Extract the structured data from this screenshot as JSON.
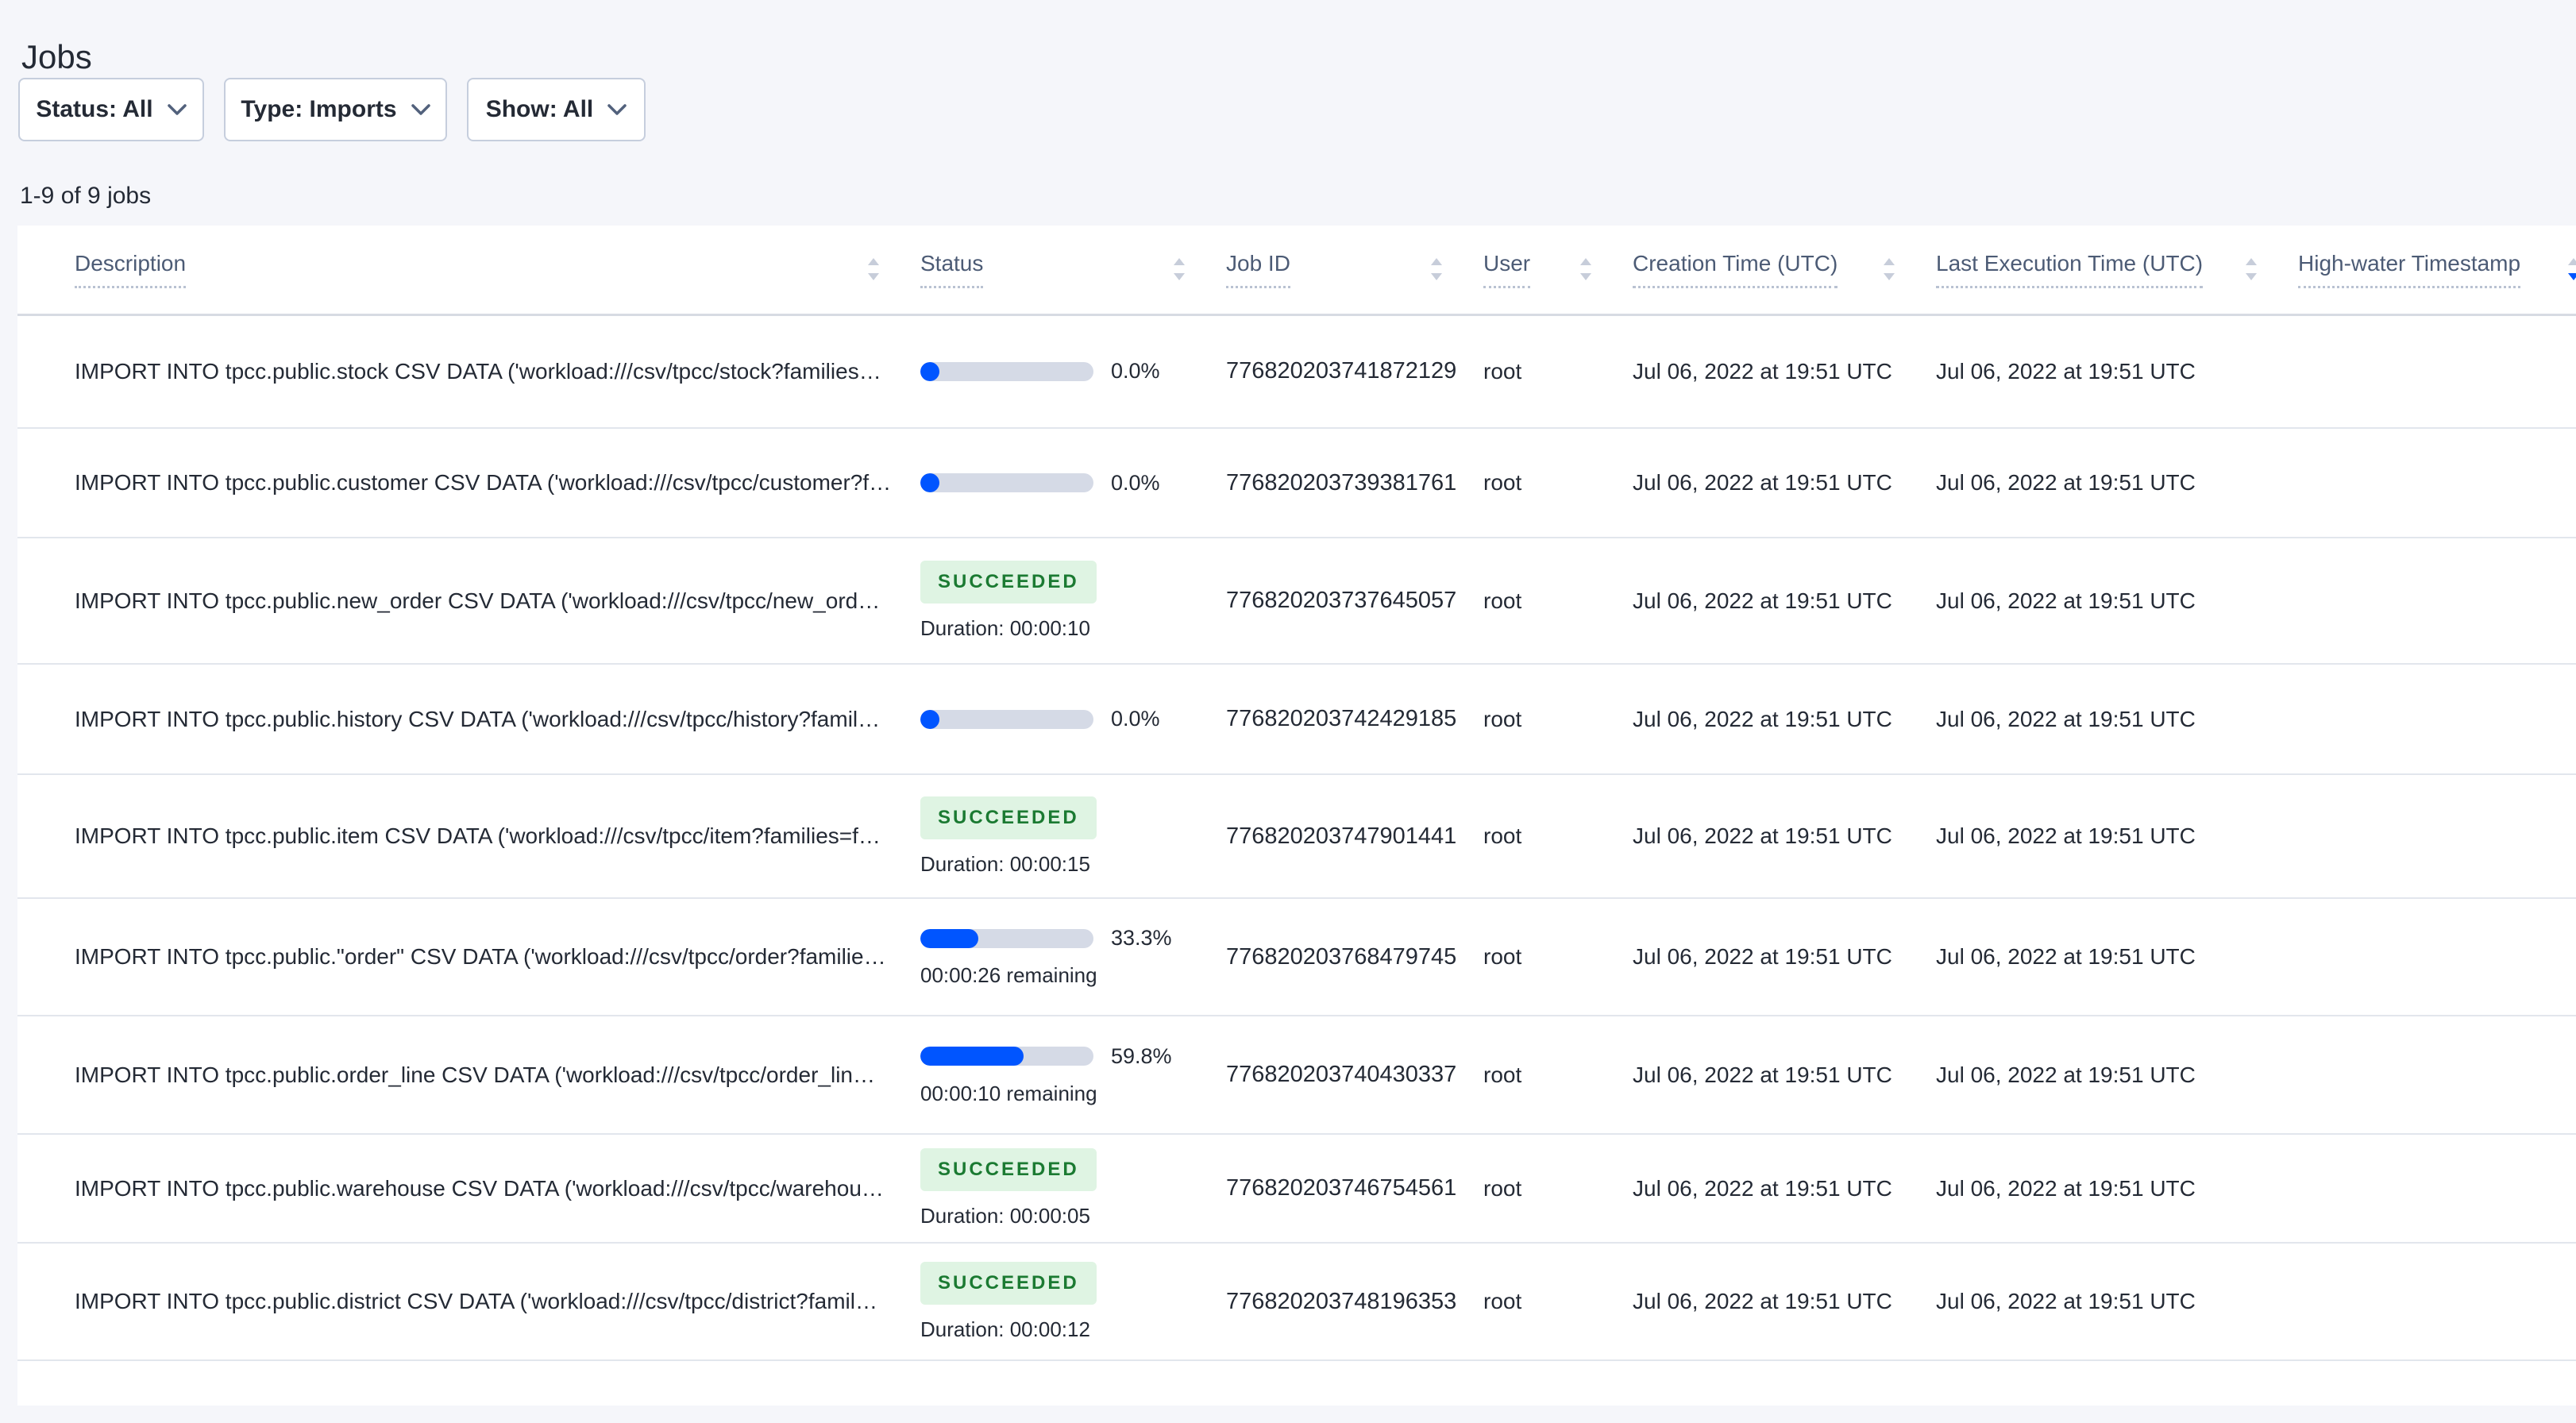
{
  "page": {
    "title": "Jobs",
    "summary": "1-9 of 9 jobs"
  },
  "filters": {
    "status_label": "Status: All",
    "type_label": "Type: Imports",
    "show_label": "Show: All"
  },
  "table": {
    "columns": [
      "Description",
      "Status",
      "Job ID",
      "User",
      "Creation Time (UTC)",
      "Last Execution Time (UTC)",
      "High-water Timestamp"
    ],
    "sort": {
      "column": "High-water Timestamp",
      "direction": "desc"
    },
    "succeeded_label": "SUCCEEDED",
    "rows": [
      {
        "description": "IMPORT INTO tpcc.public.stock CSV DATA ('workload:///csv/tpcc/stock?families…",
        "status": {
          "state": "running",
          "percent": "0.0%",
          "fraction": 0.0,
          "remaining": null
        },
        "job_id": "776820203741872129",
        "user": "root",
        "creation_time": "Jul 06, 2022 at 19:51 UTC",
        "last_execution_time": "Jul 06, 2022 at 19:51 UTC",
        "high_water": ""
      },
      {
        "description": "IMPORT INTO tpcc.public.customer CSV DATA ('workload:///csv/tpcc/customer?f…",
        "status": {
          "state": "running",
          "percent": "0.0%",
          "fraction": 0.0,
          "remaining": null
        },
        "job_id": "776820203739381761",
        "user": "root",
        "creation_time": "Jul 06, 2022 at 19:51 UTC",
        "last_execution_time": "Jul 06, 2022 at 19:51 UTC",
        "high_water": ""
      },
      {
        "description": "IMPORT INTO tpcc.public.new_order CSV DATA ('workload:///csv/tpcc/new_ord…",
        "status": {
          "state": "succeeded",
          "duration": "Duration: 00:00:10"
        },
        "job_id": "776820203737645057",
        "user": "root",
        "creation_time": "Jul 06, 2022 at 19:51 UTC",
        "last_execution_time": "Jul 06, 2022 at 19:51 UTC",
        "high_water": ""
      },
      {
        "description": "IMPORT INTO tpcc.public.history CSV DATA ('workload:///csv/tpcc/history?famil…",
        "status": {
          "state": "running",
          "percent": "0.0%",
          "fraction": 0.0,
          "remaining": null
        },
        "job_id": "776820203742429185",
        "user": "root",
        "creation_time": "Jul 06, 2022 at 19:51 UTC",
        "last_execution_time": "Jul 06, 2022 at 19:51 UTC",
        "high_water": ""
      },
      {
        "description": "IMPORT INTO tpcc.public.item CSV DATA ('workload:///csv/tpcc/item?families=f…",
        "status": {
          "state": "succeeded",
          "duration": "Duration: 00:00:15"
        },
        "job_id": "776820203747901441",
        "user": "root",
        "creation_time": "Jul 06, 2022 at 19:51 UTC",
        "last_execution_time": "Jul 06, 2022 at 19:51 UTC",
        "high_water": ""
      },
      {
        "description": "IMPORT INTO tpcc.public.\"order\" CSV DATA ('workload:///csv/tpcc/order?familie…",
        "status": {
          "state": "running",
          "percent": "33.3%",
          "fraction": 0.333,
          "remaining": "00:00:26 remaining"
        },
        "job_id": "776820203768479745",
        "user": "root",
        "creation_time": "Jul 06, 2022 at 19:51 UTC",
        "last_execution_time": "Jul 06, 2022 at 19:51 UTC",
        "high_water": ""
      },
      {
        "description": "IMPORT INTO tpcc.public.order_line CSV DATA ('workload:///csv/tpcc/order_lin…",
        "status": {
          "state": "running",
          "percent": "59.8%",
          "fraction": 0.598,
          "remaining": "00:00:10 remaining"
        },
        "job_id": "776820203740430337",
        "user": "root",
        "creation_time": "Jul 06, 2022 at 19:51 UTC",
        "last_execution_time": "Jul 06, 2022 at 19:51 UTC",
        "high_water": ""
      },
      {
        "description": "IMPORT INTO tpcc.public.warehouse CSV DATA ('workload:///csv/tpcc/warehou…",
        "status": {
          "state": "succeeded",
          "duration": "Duration: 00:00:05"
        },
        "job_id": "776820203746754561",
        "user": "root",
        "creation_time": "Jul 06, 2022 at 19:51 UTC",
        "last_execution_time": "Jul 06, 2022 at 19:51 UTC",
        "high_water": ""
      },
      {
        "description": "IMPORT INTO tpcc.public.district CSV DATA ('workload:///csv/tpcc/district?famil…",
        "status": {
          "state": "succeeded",
          "duration": "Duration: 00:00:12"
        },
        "job_id": "776820203748196353",
        "user": "root",
        "creation_time": "Jul 06, 2022 at 19:51 UTC",
        "last_execution_time": "Jul 06, 2022 at 19:51 UTC",
        "high_water": ""
      }
    ]
  },
  "colors": {
    "accent_blue": "#0055ff",
    "success_text": "#1b7a32",
    "success_bg": "#dff4e3",
    "progress_track": "#d5dae6"
  }
}
